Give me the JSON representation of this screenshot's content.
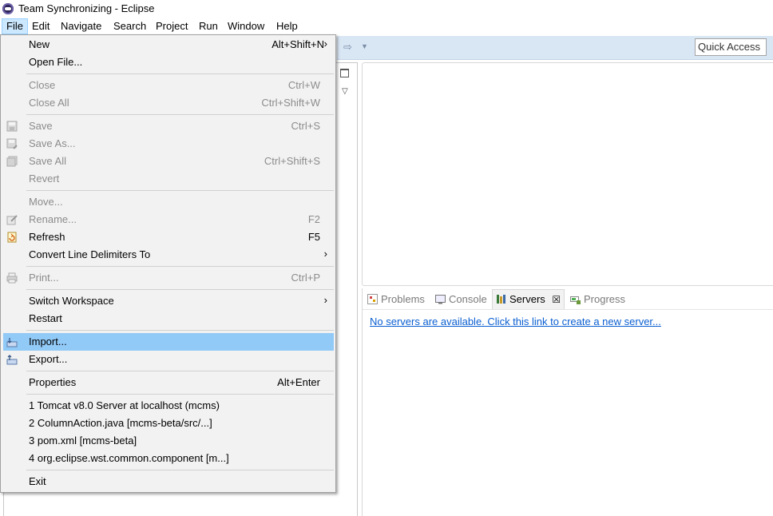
{
  "window": {
    "title": "Team Synchronizing - Eclipse"
  },
  "menubar": [
    "File",
    "Edit",
    "Navigate",
    "Search",
    "Project",
    "Run",
    "Window",
    "Help"
  ],
  "toolbar": {
    "quick_access": "Quick Access"
  },
  "bottom_panel": {
    "tabs": [
      "Problems",
      "Console",
      "Servers",
      "Progress"
    ],
    "active_tab": "Servers",
    "link": "No servers are available. Click this link to create a new server..."
  },
  "file_menu": {
    "items": [
      {
        "label": "New",
        "shortcut": "Alt+Shift+N"
      },
      {
        "label": "Open File..."
      },
      {
        "label": "Close",
        "shortcut": "Ctrl+W"
      },
      {
        "label": "Close All",
        "shortcut": "Ctrl+Shift+W"
      },
      {
        "label": "Save",
        "shortcut": "Ctrl+S"
      },
      {
        "label": "Save As..."
      },
      {
        "label": "Save All",
        "shortcut": "Ctrl+Shift+S"
      },
      {
        "label": "Revert"
      },
      {
        "label": "Move..."
      },
      {
        "label": "Rename...",
        "shortcut": "F2"
      },
      {
        "label": "Refresh",
        "shortcut": "F5"
      },
      {
        "label": "Convert Line Delimiters To"
      },
      {
        "label": "Print...",
        "shortcut": "Ctrl+P"
      },
      {
        "label": "Switch Workspace"
      },
      {
        "label": "Restart"
      },
      {
        "label": "Import..."
      },
      {
        "label": "Export..."
      },
      {
        "label": "Properties",
        "shortcut": "Alt+Enter"
      },
      {
        "label": "1 Tomcat v8.0 Server at localhost (mcms)"
      },
      {
        "label": "2 ColumnAction.java  [mcms-beta/src/...]"
      },
      {
        "label": "3 pom.xml  [mcms-beta]"
      },
      {
        "label": "4 org.eclipse.wst.common.component  [m...]"
      },
      {
        "label": "Exit"
      }
    ]
  }
}
